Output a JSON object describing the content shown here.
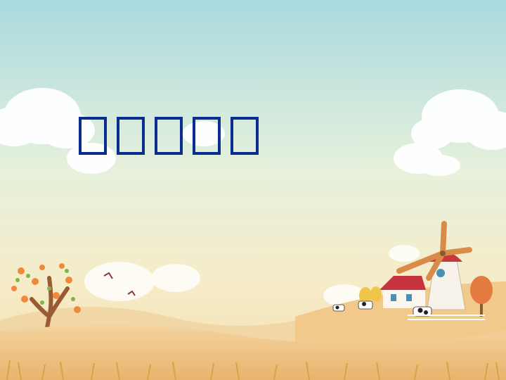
{
  "slide": {
    "title_text": "",
    "title_placeholder_glyph_count": 5,
    "colors": {
      "sky_top": "#a9d9de",
      "sky_mid": "#e7f1dc",
      "horizon": "#f6ecc8",
      "field": "#f0c98b",
      "field_dark": "#e3a85e",
      "title": "#0a2d8f",
      "cloud": "#ffffff"
    }
  }
}
